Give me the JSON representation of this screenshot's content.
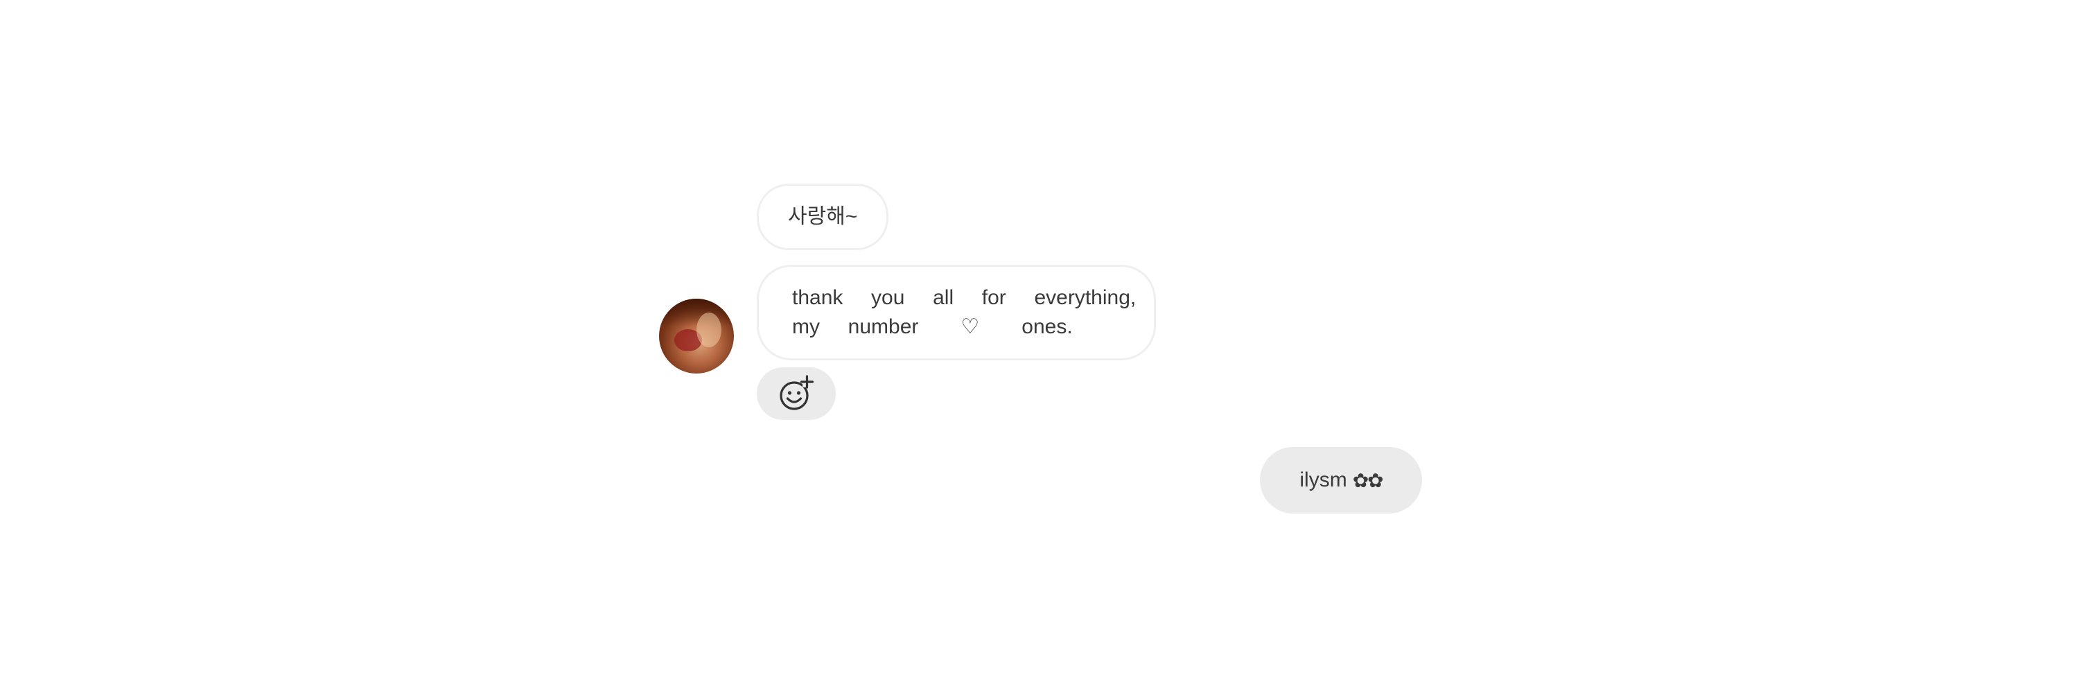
{
  "messages": {
    "received": [
      {
        "text": "사랑해~"
      },
      {
        "lines": [
          "thank  you  all  for  everything,",
          "my  number   ♡   ones."
        ]
      }
    ],
    "sent": [
      {
        "text": "ilysm",
        "emoji": "✿✿"
      }
    ]
  },
  "icons": {
    "add_reaction": "add-reaction-icon",
    "avatar": "user-avatar"
  },
  "colors": {
    "background": "#ffffff",
    "received_border": "#efefef",
    "sent_bubble": "#ebebeb",
    "reaction_button": "#ebebeb",
    "text": "#3a3a3a"
  }
}
